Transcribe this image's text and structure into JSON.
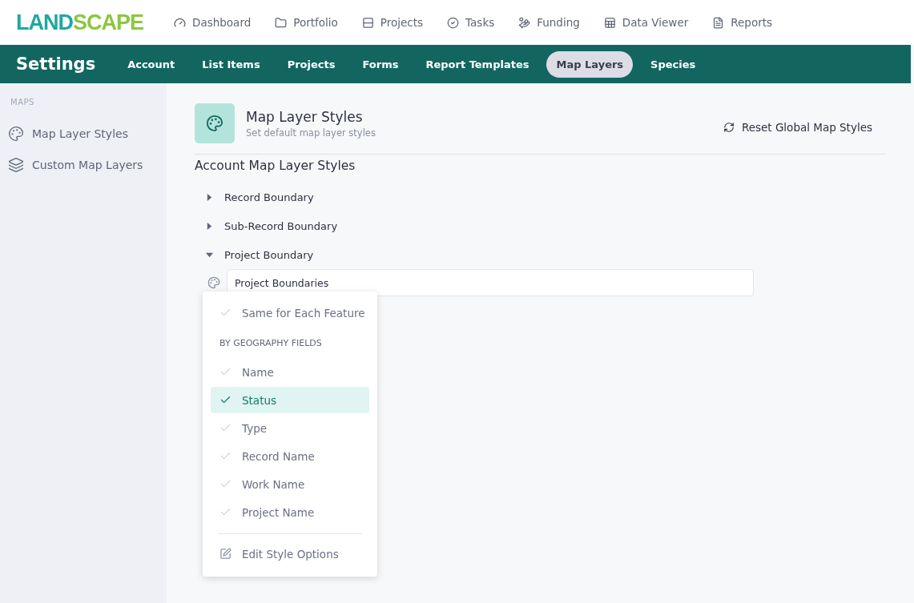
{
  "logo": {
    "part_1": "LAND",
    "part_2": "SCAPE"
  },
  "top_nav": [
    {
      "label": "Dashboard"
    },
    {
      "label": "Portfolio"
    },
    {
      "label": "Projects"
    },
    {
      "label": "Tasks"
    },
    {
      "label": "Funding"
    },
    {
      "label": "Data Viewer"
    },
    {
      "label": "Reports"
    }
  ],
  "settings_bar": {
    "title": "Settings",
    "tabs": [
      {
        "label": "Account",
        "selected": false
      },
      {
        "label": "List Items",
        "selected": false
      },
      {
        "label": "Projects",
        "selected": false
      },
      {
        "label": "Forms",
        "selected": false
      },
      {
        "label": "Report Templates",
        "selected": false
      },
      {
        "label": "Map Layers",
        "selected": true
      },
      {
        "label": "Species",
        "selected": false
      }
    ]
  },
  "sidebar": {
    "section": "MAPS",
    "items": [
      {
        "label": "Map Layer Styles"
      },
      {
        "label": "Custom Map Layers"
      }
    ]
  },
  "page_header": {
    "title": "Map Layer Styles",
    "subtitle": "Set default map layer styles",
    "reset_button": "Reset Global Map Styles"
  },
  "section_title": "Account Map Layer Styles",
  "layers": [
    {
      "label": "Record Boundary",
      "expanded": false
    },
    {
      "label": "Sub-Record Boundary",
      "expanded": false
    },
    {
      "label": "Project Boundary",
      "expanded": true,
      "field_value": "Project Boundaries"
    }
  ],
  "menu": [
    {
      "kind": "option",
      "label": "Same for Each Feature",
      "selected": false
    },
    {
      "kind": "header",
      "label": "BY GEOGRAPHY FIELDS"
    },
    {
      "kind": "option",
      "label": "Name",
      "selected": false
    },
    {
      "kind": "option",
      "label": "Status",
      "selected": true
    },
    {
      "kind": "option",
      "label": "Type",
      "selected": false
    },
    {
      "kind": "option",
      "label": "Record Name",
      "selected": false
    },
    {
      "kind": "option",
      "label": "Work Name",
      "selected": false
    },
    {
      "kind": "option",
      "label": "Project Name",
      "selected": false
    },
    {
      "kind": "divider"
    },
    {
      "kind": "action",
      "label": "Edit Style Options"
    }
  ]
}
